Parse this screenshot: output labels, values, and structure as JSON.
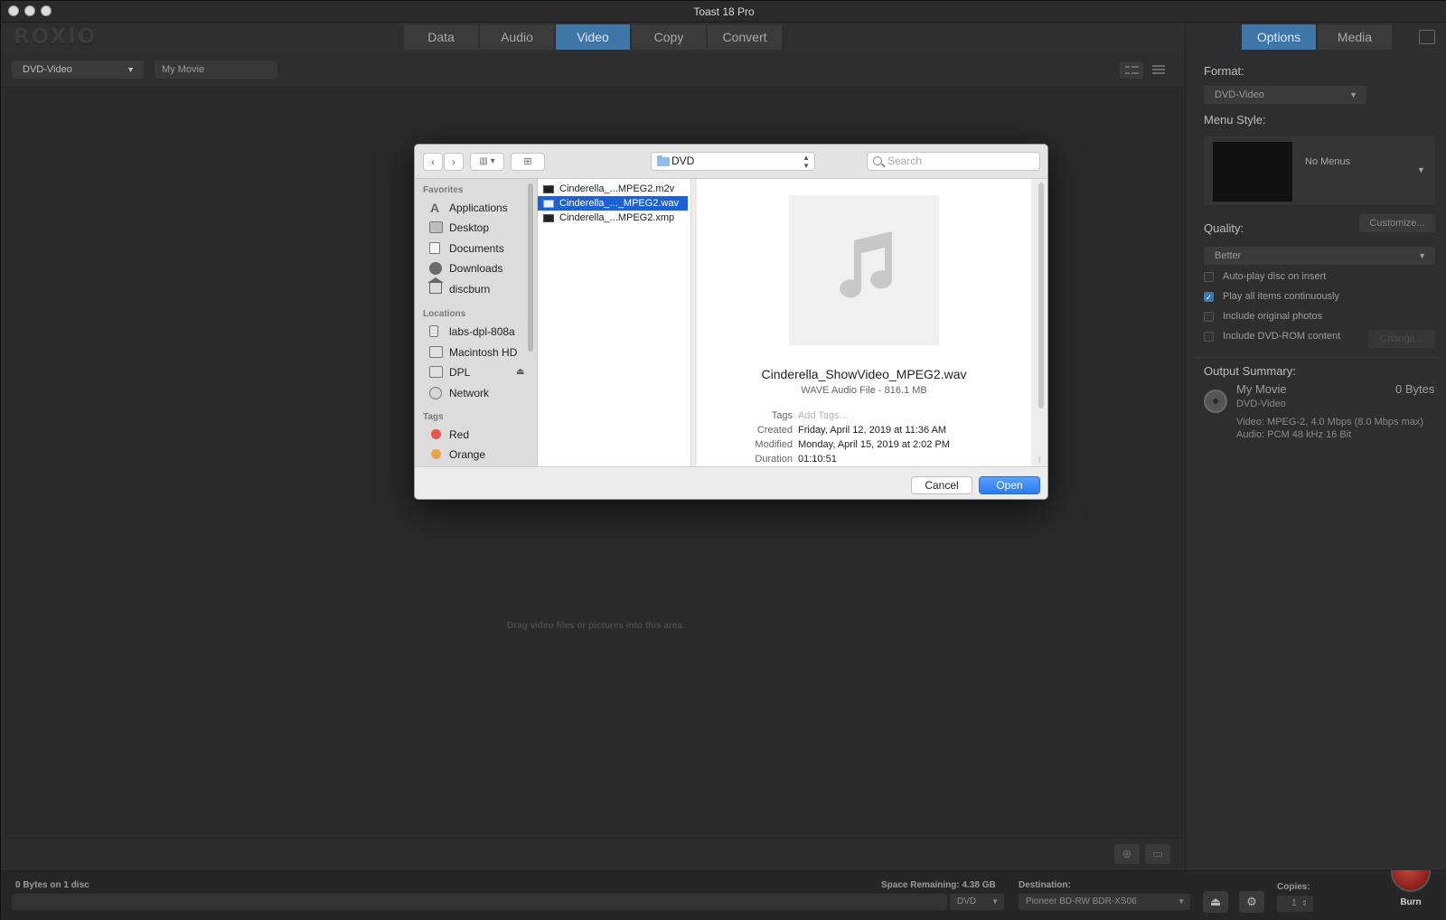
{
  "window": {
    "title": "Toast 18 Pro"
  },
  "toolbar": {
    "logo": "ROXIO",
    "tabs": [
      {
        "label": "Data",
        "active": false
      },
      {
        "label": "Audio",
        "active": false
      },
      {
        "label": "Video",
        "active": true
      },
      {
        "label": "Copy",
        "active": false
      },
      {
        "label": "Convert",
        "active": false
      }
    ]
  },
  "subbar": {
    "format": "DVD-Video",
    "movie_name": "My Movie"
  },
  "content": {
    "drop_hint": "Drag video files or pictures into this area"
  },
  "status": {
    "bytes_on_disc": "0 Bytes on 1 disc",
    "space_remaining": "Space Remaining: 4.38 GB",
    "disc_type": "DVD",
    "destination_label": "Destination:",
    "destination_value": "Pioneer BD-RW   BDR-XS06",
    "copies_label": "Copies:",
    "copies_value": "1",
    "burn_label": "Burn"
  },
  "right_panel": {
    "tabs": [
      {
        "label": "Options",
        "active": true
      },
      {
        "label": "Media",
        "active": false
      }
    ],
    "format_label": "Format:",
    "format_value": "DVD-Video",
    "menu_style_label": "Menu Style:",
    "menu_style_value": "No Menus",
    "customize_label": "Customize...",
    "quality_label": "Quality:",
    "quality_value": "Better",
    "options": [
      {
        "label": "Auto-play disc on insert",
        "checked": false
      },
      {
        "label": "Play all items continuously",
        "checked": true
      },
      {
        "label": "Include original photos",
        "checked": false
      },
      {
        "label": "Include DVD-ROM content",
        "checked": false
      }
    ],
    "change_label": "Change...",
    "output_summary_label": "Output Summary:",
    "output_name": "My Movie",
    "output_size": "0 Bytes",
    "output_format": "DVD-Video",
    "output_video": "Video: MPEG-2, 4.0 Mbps (8.0 Mbps max)",
    "output_audio": "Audio: PCM 48 kHz 16 Bit"
  },
  "dialog": {
    "path": "DVD",
    "search_placeholder": "Search",
    "sidebar": {
      "favorites_heading": "Favorites",
      "favorites": [
        "Applications",
        "Desktop",
        "Documents",
        "Downloads",
        "discburn"
      ],
      "locations_heading": "Locations",
      "locations": [
        "labs-dpl-808a",
        "Macintosh HD",
        "DPL",
        "Network"
      ],
      "tags_heading": "Tags",
      "tags": [
        {
          "label": "Red",
          "color": "#f0504a"
        },
        {
          "label": "Orange",
          "color": "#f5a340"
        }
      ]
    },
    "files": [
      {
        "name": "Cinderella_...MPEG2.m2v",
        "selected": false
      },
      {
        "name": "Cinderella_..._MPEG2.wav",
        "selected": true
      },
      {
        "name": "Cinderella_...MPEG2.xmp",
        "selected": false
      }
    ],
    "preview": {
      "name": "Cinderella_ShowVideo_MPEG2.wav",
      "kind": "WAVE Audio File - 816.1 MB",
      "tags_label": "Tags",
      "tags_placeholder": "Add Tags...",
      "created_label": "Created",
      "created_value": "Friday, April 12, 2019 at 11:36 AM",
      "modified_label": "Modified",
      "modified_value": "Monday, April 15, 2019 at 2:02 PM",
      "duration_label": "Duration",
      "duration_value": "01:10:51"
    },
    "cancel_label": "Cancel",
    "open_label": "Open"
  }
}
